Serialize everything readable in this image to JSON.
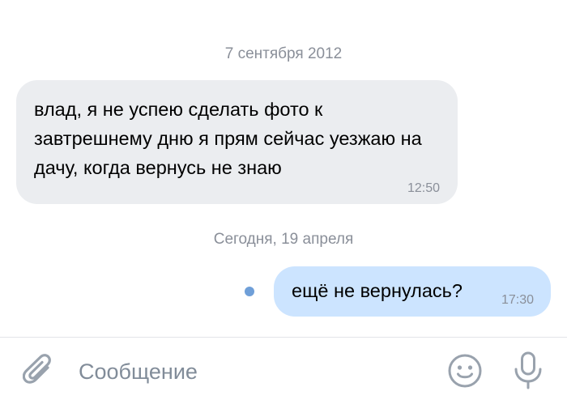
{
  "chat": {
    "date_separator_1": "7 сентября 2012",
    "incoming_message": {
      "text": "влад, я не успею сделать фото к завтрешнему дню я прям сейчас уезжаю на дачу, когда вернусь не знаю",
      "time": "12:50"
    },
    "date_separator_2": "Сегодня, 19 апреля",
    "outgoing_message": {
      "text": "ещё не вернулась?",
      "time": "17:30",
      "status": "unread"
    }
  },
  "composer": {
    "placeholder": "Сообщение",
    "value": ""
  },
  "icons": {
    "attach": "paperclip-icon",
    "emoji": "smiley-icon",
    "voice": "microphone-icon"
  },
  "colors": {
    "incoming_bubble": "#ebedf0",
    "outgoing_bubble": "#cce4ff",
    "unread_dot": "#6f9fd8",
    "secondary_text": "#8a8f99",
    "icon_gray": "#99a2ad"
  }
}
